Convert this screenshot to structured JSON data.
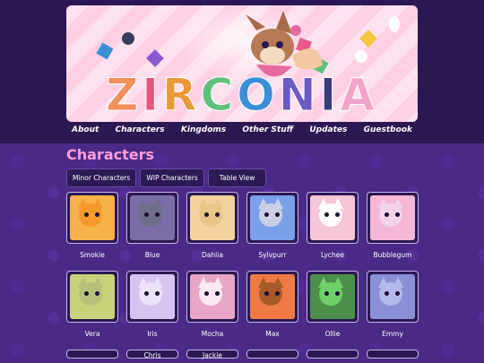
{
  "site": {
    "logo_text": "ZIRCONIA"
  },
  "nav": [
    "About",
    "Characters",
    "Kingdoms",
    "Other Stuff",
    "Updates",
    "Guestbook"
  ],
  "page_title": "Characters",
  "view_buttons": [
    "Minor Characters",
    "WIP Characters",
    "Table View"
  ],
  "characters_row1": [
    {
      "name": "Smokie",
      "bg": "#f7b24a",
      "fur": "#f39a2b"
    },
    {
      "name": "Blue",
      "bg": "#7a6da8",
      "fur": "#6f6f8a"
    },
    {
      "name": "Dahlia",
      "bg": "#f3d2a0",
      "fur": "#e9c58a"
    },
    {
      "name": "Sylvpurr",
      "bg": "#7aa0ea",
      "fur": "#c9d0e6"
    },
    {
      "name": "Lychee",
      "bg": "#f6c6d6",
      "fur": "#ffffff"
    },
    {
      "name": "Bubblegum",
      "bg": "#f4b8d4",
      "fur": "#f2d4e6"
    }
  ],
  "characters_row2": [
    {
      "name": "Vera",
      "bg": "#c9d27a",
      "fur": "#b7c07a"
    },
    {
      "name": "Iris",
      "bg": "#d7c3f0",
      "fur": "#ece3fb"
    },
    {
      "name": "Mocha",
      "bg": "#e8a6c4",
      "fur": "#fbe8f2"
    },
    {
      "name": "Max",
      "bg": "#f07a45",
      "fur": "#a65a2a"
    },
    {
      "name": "Ollie",
      "bg": "#4c8f4a",
      "fur": "#6fd06a"
    },
    {
      "name": "Emmy",
      "bg": "#8a8fd6",
      "fur": "#b5b8ea"
    }
  ],
  "characters_row3": [
    "",
    "Chris",
    "Jackie",
    "",
    "",
    ""
  ],
  "colors": {
    "accent": "#ff9ed8",
    "page_bg": "#4a2a86",
    "header_bg": "#2b1752"
  },
  "logo_colors": [
    "#f28f5a",
    "#e6557d",
    "#e89a3a",
    "#5fc27a",
    "#3a8fd6",
    "#6a5ac2",
    "#3a3a7a",
    "#f2a4c8"
  ]
}
